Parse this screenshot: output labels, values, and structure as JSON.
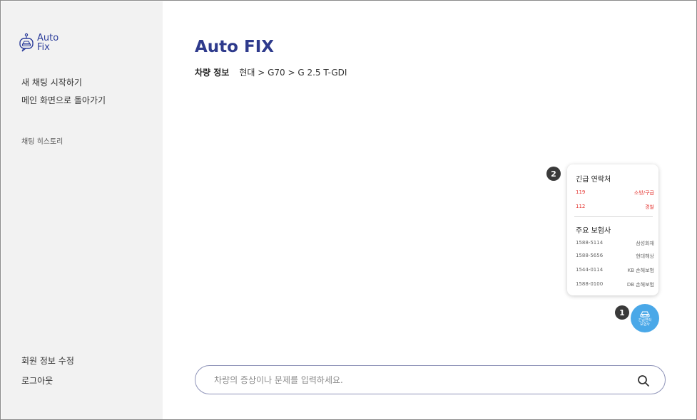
{
  "brand": {
    "logo_line1": "Auto",
    "logo_line2": "Fix"
  },
  "sidebar": {
    "new_chat": "새 채팅 시작하기",
    "back_home": "메인 화면으로 돌아가기",
    "history_label": "채팅 히스토리",
    "edit_profile": "회원 정보 수정",
    "logout": "로그아웃"
  },
  "main": {
    "title": "Auto FIX",
    "vehicle_label": "차량 정보",
    "vehicle_value": "현대 > G70 > G 2.5 T-GDI"
  },
  "contact_card": {
    "emergency_title": "긴급 연락처",
    "emergency": [
      {
        "number": "119",
        "name": "소방/구급"
      },
      {
        "number": "112",
        "name": "경찰"
      }
    ],
    "insurer_title": "주요 보험사",
    "insurers": [
      {
        "number": "1588-5114",
        "name": "삼성화재"
      },
      {
        "number": "1588-5656",
        "name": "현대해상"
      },
      {
        "number": "1544-0114",
        "name": "KB 손해보험"
      },
      {
        "number": "1588-0100",
        "name": "DB 손해보험"
      }
    ]
  },
  "badges": {
    "fab_badge": "1",
    "card_badge": "2"
  },
  "fab": {
    "line1": "긴급연락",
    "line2": "보험사"
  },
  "search": {
    "placeholder": "차량의 증상이나 문제를 입력하세요.",
    "value": ""
  },
  "colors": {
    "brand": "#2e3a8c",
    "sidebar_bg": "#f2f2f2",
    "emergency_text": "#e53935",
    "fab_bg": "#4aa8e8",
    "search_border": "#8e93b8"
  },
  "icons": {
    "logo": "car-chat-logo-icon",
    "fab": "car-icon",
    "search": "search-icon"
  }
}
